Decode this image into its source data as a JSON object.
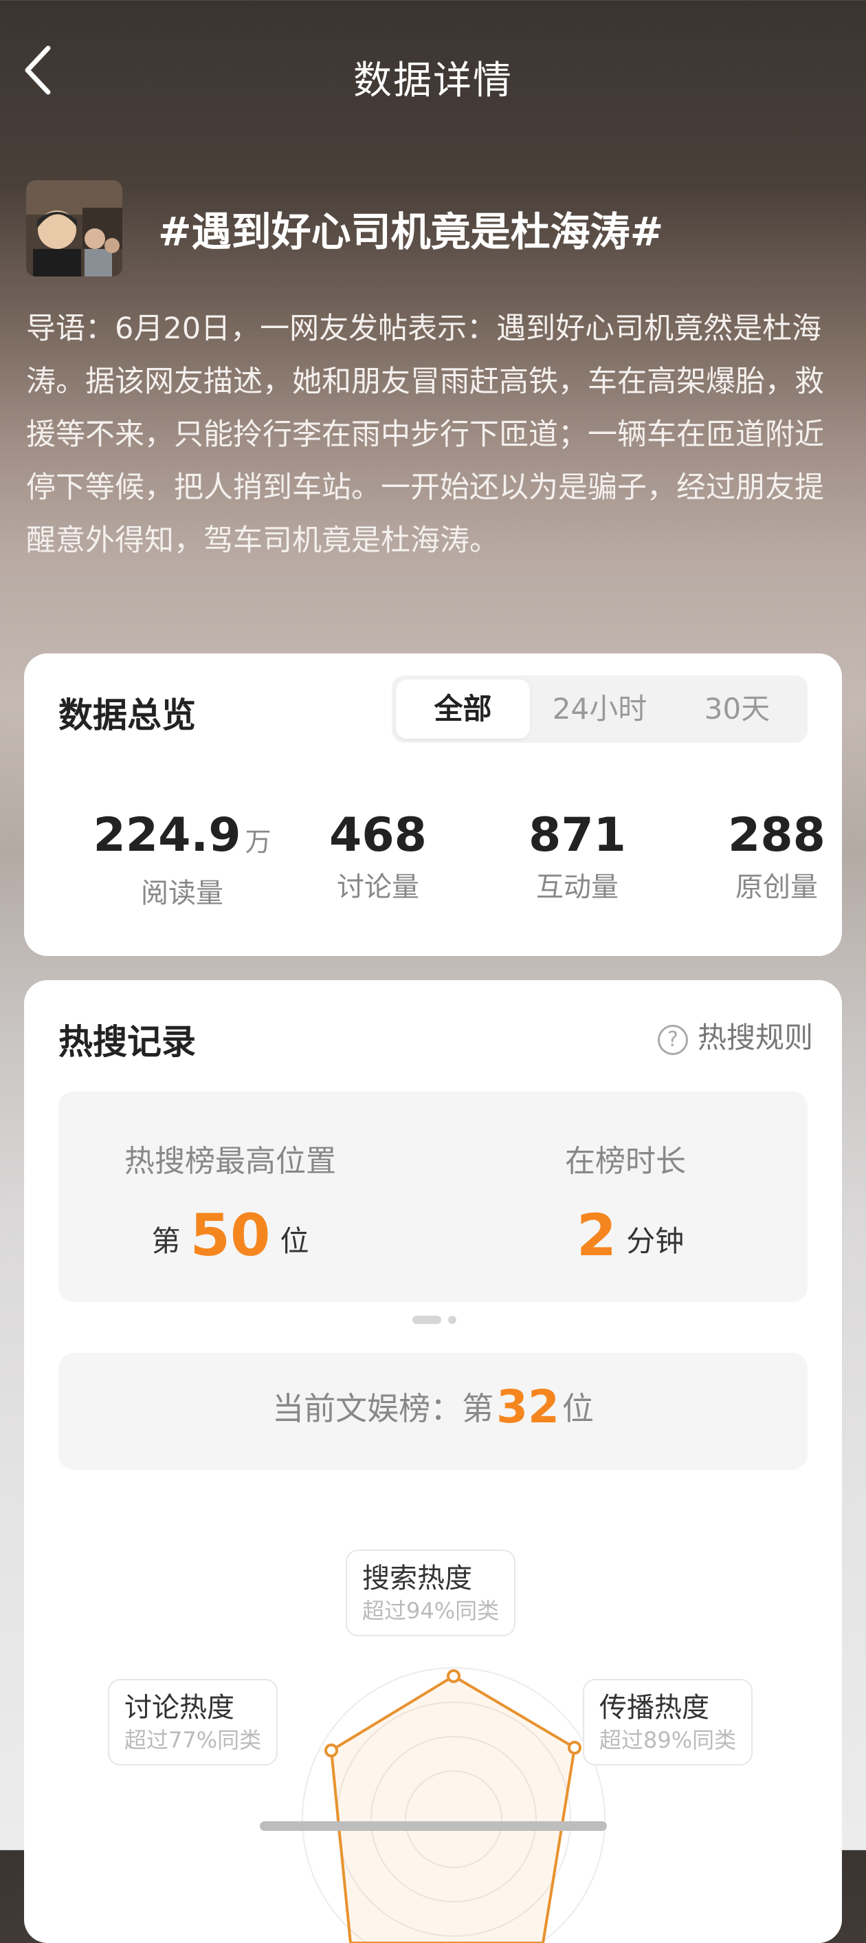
{
  "header": {
    "title": "数据详情"
  },
  "topic": {
    "title": "#遇到好心司机竟是杜海涛#",
    "intro": "导语：6月20日，一网友发帖表示：遇到好心司机竟然是杜海涛。据该网友描述，她和朋友冒雨赶高铁，车在高架爆胎，救援等不来，只能拎行李在雨中步行下匝道；一辆车在匝道附近停下等候，把人捎到车站。一开始还以为是骗子，经过朋友提醒意外得知，驾车司机竟是杜海涛。"
  },
  "overview": {
    "title": "数据总览",
    "tabs": [
      "全部",
      "24小时",
      "30天"
    ],
    "active_tab": "全部",
    "stats": [
      {
        "value": "224.9",
        "unit": "万",
        "label": "阅读量"
      },
      {
        "value": "468",
        "label": "讨论量"
      },
      {
        "value": "871",
        "label": "互动量"
      },
      {
        "value": "288",
        "label": "原创量"
      }
    ]
  },
  "hot": {
    "title": "热搜记录",
    "rules_label": "热搜规则",
    "peak_label": "热搜榜最高位置",
    "peak_prefix": "第",
    "peak_value": "50",
    "peak_suffix": "位",
    "duration_label": "在榜时长",
    "duration_value": "2",
    "duration_unit": "分钟",
    "current_prefix": "当前文娱榜：第",
    "current_value": "32",
    "current_suffix": "位",
    "radar": [
      {
        "title": "搜索热度",
        "sub": "超过94%同类"
      },
      {
        "title": "讨论热度",
        "sub": "超过77%同类"
      },
      {
        "title": "传播热度",
        "sub": "超过89%同类"
      }
    ]
  },
  "colors": {
    "accent": "#f5861f"
  }
}
